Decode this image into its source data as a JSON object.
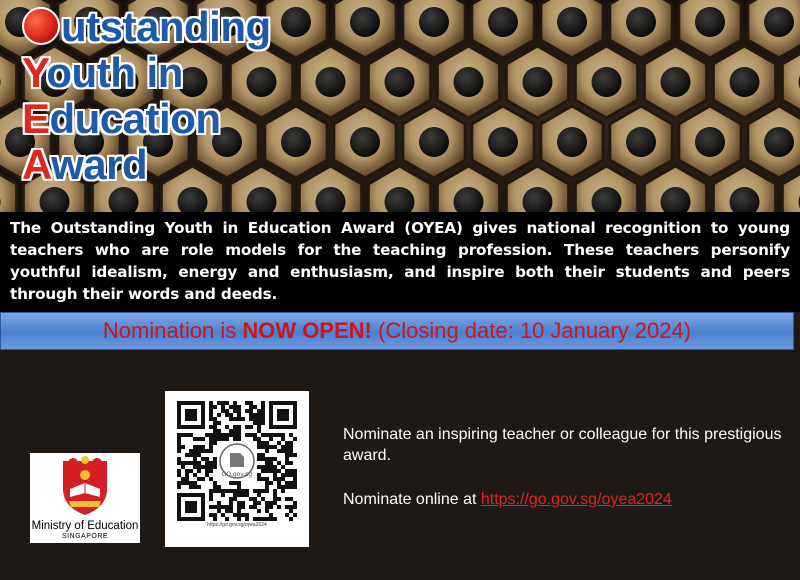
{
  "title": {
    "lines": [
      {
        "cap": "",
        "rest": "utstanding"
      },
      {
        "cap": "Y",
        "rest": "outh in"
      },
      {
        "cap": "E",
        "rest": "ducation"
      },
      {
        "cap": "A",
        "rest": "ward"
      }
    ]
  },
  "description": "The Outstanding Youth in Education Award (OYEA) gives national recognition to young teachers who are role models for the teaching profession. These teachers personify youthful idealism, energy and enthusiasm, and inspire both their students and peers through their words and deeds.",
  "nomination": {
    "prefix": "Nomination is ",
    "highlight": "NOW OPEN!",
    "suffix": " (Closing date: 10 January 2024)"
  },
  "logo": {
    "org_name": "Ministry of Education",
    "country": "SINGAPORE"
  },
  "qr": {
    "center_label": "GO.gov.sg",
    "caption": "https://go.gov.sg/oyea2024"
  },
  "info": {
    "line1": "Nominate an inspiring teacher or colleague for this prestigious award.",
    "line2_prefix": "Nominate online at ",
    "link_text": "https://go.gov.sg/oyea2024"
  },
  "colors": {
    "title_blue": "#1f5aa8",
    "title_red": "#e0271f",
    "bar_blue": "#4b7fcf",
    "alert_red": "#c9171e",
    "link_red": "#e0241b"
  }
}
